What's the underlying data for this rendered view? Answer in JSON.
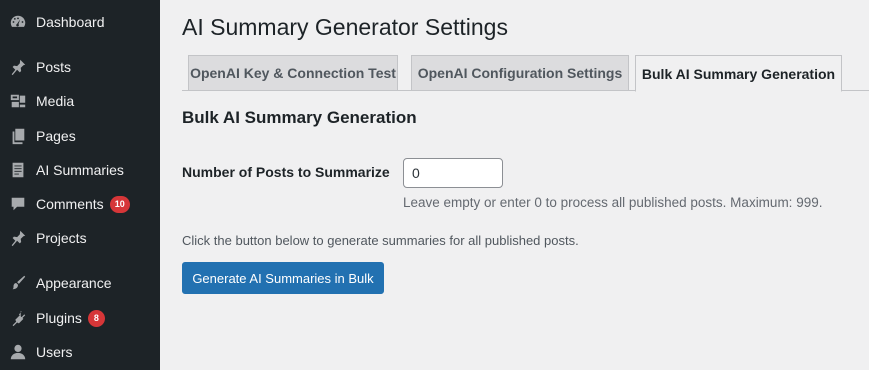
{
  "sidebar": {
    "items": [
      {
        "label": "Dashboard",
        "icon": "dashboard-icon"
      },
      {
        "label": "Posts",
        "icon": "pin-icon"
      },
      {
        "label": "Media",
        "icon": "media-icon"
      },
      {
        "label": "Pages",
        "icon": "pages-icon"
      },
      {
        "label": "AI Summaries",
        "icon": "document-icon"
      },
      {
        "label": "Comments",
        "icon": "comment-icon",
        "badge": "10"
      },
      {
        "label": "Projects",
        "icon": "pin-icon"
      },
      {
        "label": "Appearance",
        "icon": "brush-icon"
      },
      {
        "label": "Plugins",
        "icon": "plugin-icon",
        "badge": "8"
      },
      {
        "label": "Users",
        "icon": "user-icon"
      }
    ]
  },
  "page": {
    "title": "AI Summary Generator Settings"
  },
  "tabs": [
    {
      "label": "OpenAI Key & Connection Test",
      "active": false
    },
    {
      "label": "OpenAI Configuration Settings",
      "active": false
    },
    {
      "label": "Bulk AI Summary Generation",
      "active": true
    }
  ],
  "section": {
    "title": "Bulk AI Summary Generation",
    "posts_label": "Number of Posts to Summarize",
    "posts_value": "0",
    "posts_description": "Leave empty or enter 0 to process all published posts. Maximum: 999.",
    "instructions": "Click the button below to generate summaries for all published posts.",
    "button_label": "Generate AI Summaries in Bulk"
  },
  "colors": {
    "sidebar_bg": "#1d2327",
    "primary": "#2271b1",
    "badge": "#d63638",
    "page_bg": "#f0f0f1"
  }
}
